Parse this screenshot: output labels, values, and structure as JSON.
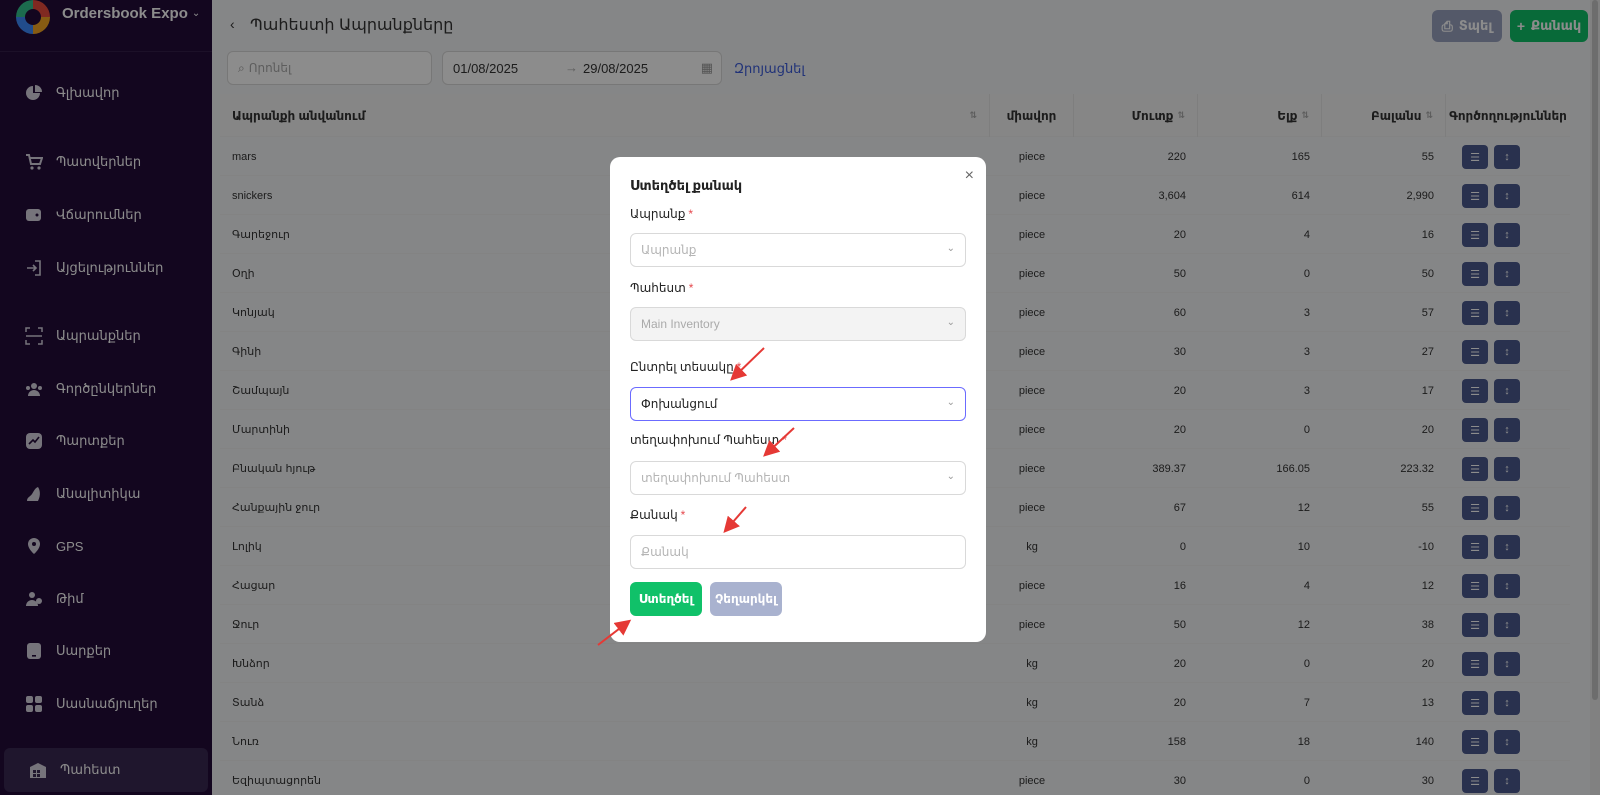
{
  "brand": {
    "name": "Ordersbook Expo"
  },
  "sidebar": {
    "items": [
      {
        "label": "Գլխավոր",
        "icon": "pie-chart-icon"
      },
      {
        "label": "Պատվերներ",
        "icon": "cart-icon"
      },
      {
        "label": "Վճարումներ",
        "icon": "wallet-icon"
      },
      {
        "label": "Այցելություններ",
        "icon": "login-icon"
      },
      {
        "label": "Ապրանքներ",
        "icon": "scan-icon"
      },
      {
        "label": "Գործընկերներ",
        "icon": "partners-icon"
      },
      {
        "label": "Պարտքեր",
        "icon": "trend-icon"
      },
      {
        "label": "Անալիտիկա",
        "icon": "analytics-icon"
      },
      {
        "label": "GPS",
        "icon": "location-icon"
      },
      {
        "label": "Թիմ",
        "icon": "team-icon"
      },
      {
        "label": "Սարքեր",
        "icon": "device-icon"
      },
      {
        "label": "Սասնաճյուղեր",
        "icon": "branches-icon"
      },
      {
        "label": "Պահեստ",
        "icon": "warehouse-icon"
      }
    ]
  },
  "header": {
    "back": "‹",
    "title": "Պահեստի Ապրանքները",
    "print_label": "Տպել",
    "add_label": "Քանակ"
  },
  "filters": {
    "search_placeholder": "Որոնել",
    "date_from": "01/08/2025",
    "date_to": "29/08/2025",
    "reset_label": "Զրոյացնել"
  },
  "table": {
    "columns": [
      "Ապրանքի անվանում",
      "միավոր",
      "Մուտք",
      "Ելք",
      "Բալանս",
      "Գործողություններ"
    ],
    "rows": [
      {
        "name": "mars",
        "unit": "piece",
        "in": "220",
        "out": "165",
        "balance": "55"
      },
      {
        "name": "snickers",
        "unit": "piece",
        "in": "3,604",
        "out": "614",
        "balance": "2,990"
      },
      {
        "name": "Գարեջուր",
        "unit": "piece",
        "in": "20",
        "out": "4",
        "balance": "16"
      },
      {
        "name": "Օղի",
        "unit": "piece",
        "in": "50",
        "out": "0",
        "balance": "50"
      },
      {
        "name": "Կոնյակ",
        "unit": "piece",
        "in": "60",
        "out": "3",
        "balance": "57"
      },
      {
        "name": "Գինի",
        "unit": "piece",
        "in": "30",
        "out": "3",
        "balance": "27"
      },
      {
        "name": "Շամպայն",
        "unit": "piece",
        "in": "20",
        "out": "3",
        "balance": "17"
      },
      {
        "name": "Մարտինի",
        "unit": "piece",
        "in": "20",
        "out": "0",
        "balance": "20"
      },
      {
        "name": "Բնական հյութ",
        "unit": "piece",
        "in": "389.37",
        "out": "166.05",
        "balance": "223.32"
      },
      {
        "name": "Հանքային ջուր",
        "unit": "piece",
        "in": "67",
        "out": "12",
        "balance": "55"
      },
      {
        "name": "Լոլիկ",
        "unit": "kg",
        "in": "0",
        "out": "10",
        "balance": "-10"
      },
      {
        "name": "Հացար",
        "unit": "piece",
        "in": "16",
        "out": "4",
        "balance": "12"
      },
      {
        "name": "Ջուր",
        "unit": "piece",
        "in": "50",
        "out": "12",
        "balance": "38"
      },
      {
        "name": "Խնձոր",
        "unit": "kg",
        "in": "20",
        "out": "0",
        "balance": "20"
      },
      {
        "name": "Տանձ",
        "unit": "kg",
        "in": "20",
        "out": "7",
        "balance": "13"
      },
      {
        "name": "Նուռ",
        "unit": "kg",
        "in": "158",
        "out": "18",
        "balance": "140"
      },
      {
        "name": "Եզիպտացորեն",
        "unit": "piece",
        "in": "30",
        "out": "0",
        "balance": "30"
      }
    ]
  },
  "modal": {
    "title": "Ստեղծել քանակ",
    "close": "×",
    "product_label": "Ապրանք",
    "product_placeholder": "Ապրանք",
    "warehouse_label": "Պահեստ",
    "warehouse_value": "Main Inventory",
    "type_label": "Ընտրել տեսակը",
    "type_value": "Փոխանցում",
    "target_label": "տեղափոխում Պահեստ",
    "target_placeholder": "տեղափոխում Պահեստ",
    "qty_label": "Քանակ",
    "qty_placeholder": "Քանակ",
    "required_mark": "*",
    "create_label": "Ստեղծել",
    "cancel_label": "Չեղարկել"
  },
  "colors": {
    "sidebar_bg": "#230b3a",
    "accent_green": "#10c169",
    "action_blue": "#4b5a8f",
    "arrow_red": "#e53935"
  }
}
